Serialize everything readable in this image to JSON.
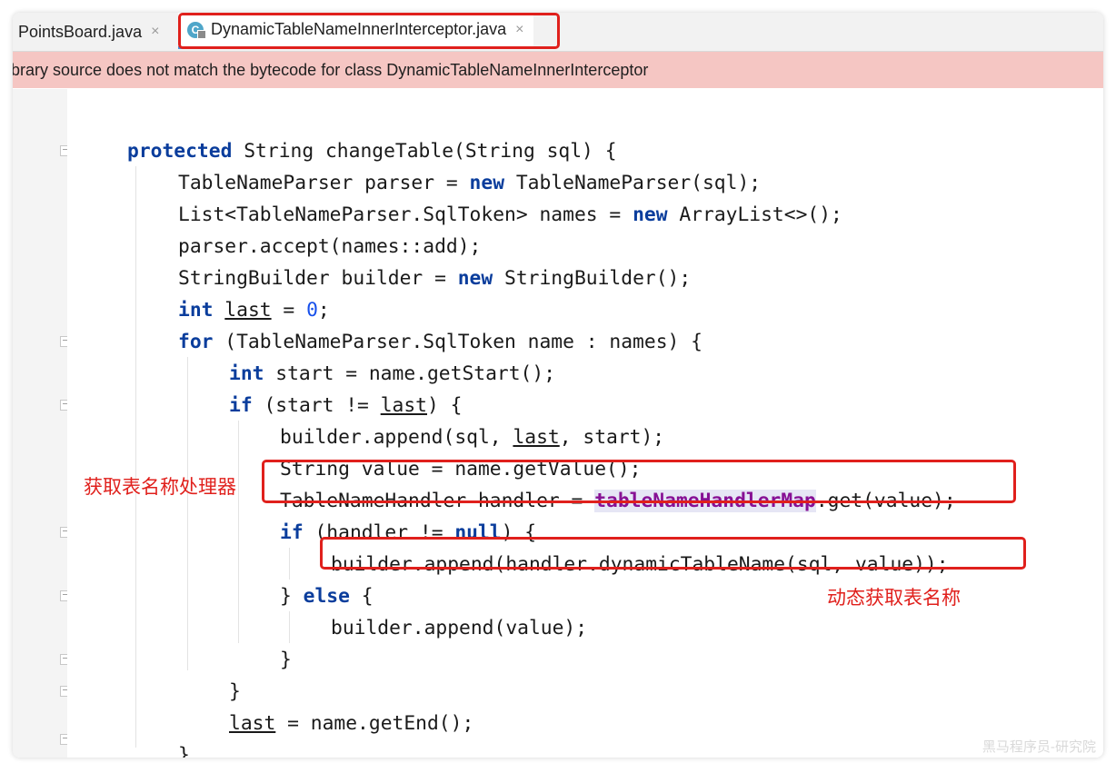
{
  "tabs": [
    {
      "label": "PointsBoard.java",
      "close": "×"
    },
    {
      "label": "DynamicTableNameInnerInterceptor.java",
      "close": "×",
      "icon": "C"
    }
  ],
  "banner": {
    "text": "ibrary source does not match the bytecode for class DynamicTableNameInnerInterceptor"
  },
  "code": {
    "l1": [
      "protected",
      " String changeTable(String sql) {"
    ],
    "l2": [
      "TableNameParser parser = ",
      "new",
      " TableNameParser(sql);"
    ],
    "l3": [
      "List<TableNameParser.SqlToken> names = ",
      "new",
      " ArrayList<>();"
    ],
    "l4": "parser.accept(names::add);",
    "l5": [
      "StringBuilder builder = ",
      "new",
      " StringBuilder();"
    ],
    "l6": [
      "int",
      " ",
      "last",
      " = ",
      "0",
      ";"
    ],
    "l7": [
      "for",
      " (TableNameParser.SqlToken name : names) {"
    ],
    "l8": [
      "int",
      " start = name.getStart();"
    ],
    "l9": [
      "if",
      " (start != ",
      "last",
      ") {"
    ],
    "l10": [
      "builder.append(sql, ",
      "last",
      ", start);"
    ],
    "l11": "String value = name.getValue();",
    "l12": [
      "TableNameHandler handler = ",
      "tableNameHandlerMap",
      ".get(value);"
    ],
    "l13": [
      "if",
      " (handler != ",
      "null",
      ") {"
    ],
    "l14": "builder.append(handler.dynamicTableName(sql, value));",
    "l15": [
      "} ",
      "else",
      " {"
    ],
    "l16": "builder.append(value);",
    "l17": "}",
    "l18": "}",
    "l19": [
      "last",
      " = name.getEnd();"
    ],
    "l20": "}"
  },
  "annotations": {
    "handler": "获取表名称处理器",
    "dynamic": "动态获取表名称"
  },
  "watermark": "黑马程序员-研究院",
  "colors": {
    "highlight": "#e0201c",
    "banner": "#f5c6c3",
    "keyword": "#0a3d9c"
  }
}
